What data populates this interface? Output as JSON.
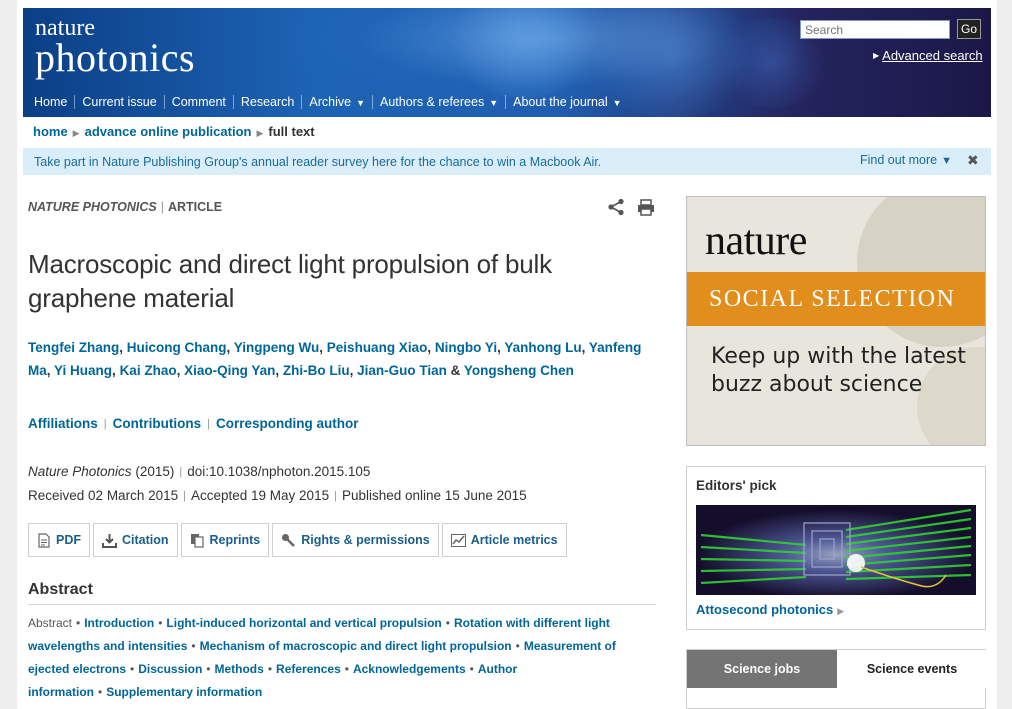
{
  "header": {
    "logo_line1": "nature",
    "logo_line2": "photonics",
    "search_placeholder": "Search",
    "go_label": "Go",
    "advanced_search": "Advanced search",
    "nav": [
      "Home",
      "Current issue",
      "Comment",
      "Research",
      "Archive",
      "Authors & referees",
      "About the journal"
    ]
  },
  "breadcrumb": {
    "home": "home",
    "aop": "advance online publication",
    "current": "full text"
  },
  "banner": {
    "text": "Take part in Nature Publishing Group's annual reader survey here for the chance to win a Macbook Air.",
    "find_out": "Find out more"
  },
  "article": {
    "journal": "NATURE PHOTONICS",
    "type": "ARTICLE",
    "title": "Macroscopic and direct light propulsion of bulk graphene material",
    "authors": [
      "Tengfei Zhang",
      "Huicong Chang",
      "Yingpeng Wu",
      "Peishuang Xiao",
      "Ningbo Yi",
      "Yanhong Lu",
      "Yanfeng Ma",
      "Yi Huang",
      "Kai Zhao",
      "Xiao-Qing Yan",
      "Zhi-Bo Liu",
      "Jian-Guo Tian",
      "Yongsheng Chen"
    ],
    "author_links": [
      "Affiliations",
      "Contributions",
      "Corresponding author"
    ],
    "citation": {
      "journal": "Nature Photonics",
      "year": "(2015)",
      "doi": "doi:10.1038/nphoton.2015.105",
      "received_label": "Received",
      "received": "02 March 2015",
      "accepted_label": "Accepted",
      "accepted": "19 May 2015",
      "published_label": "Published online",
      "published": "15 June 2015"
    },
    "tools": [
      "PDF",
      "Citation",
      "Reprints",
      "Rights & permissions",
      "Article metrics"
    ],
    "abstract_heading": "Abstract",
    "toc_first": "Abstract",
    "toc": [
      "Introduction",
      "Light-induced horizontal and vertical propulsion",
      "Rotation with different light wavelengths and intensities",
      "Mechanism of macroscopic and direct light propulsion",
      "Measurement of ejected electrons",
      "Discussion",
      "Methods",
      "References",
      "Acknowledgements",
      "Author information",
      "Supplementary information"
    ]
  },
  "sidebar": {
    "ad": {
      "brand": "nature",
      "band": "SOCIAL SELECTION",
      "tagline": "Keep up with the latest buzz about science"
    },
    "editors_pick": {
      "heading": "Editors' pick",
      "caption": "Attosecond photonics"
    },
    "tabs": [
      "Science jobs",
      "Science events"
    ]
  },
  "colors": {
    "link": "#006699",
    "banner_bg": "#d9eef8",
    "ad_orange": "#e18e1c",
    "header_blue": "#1d63b4"
  }
}
